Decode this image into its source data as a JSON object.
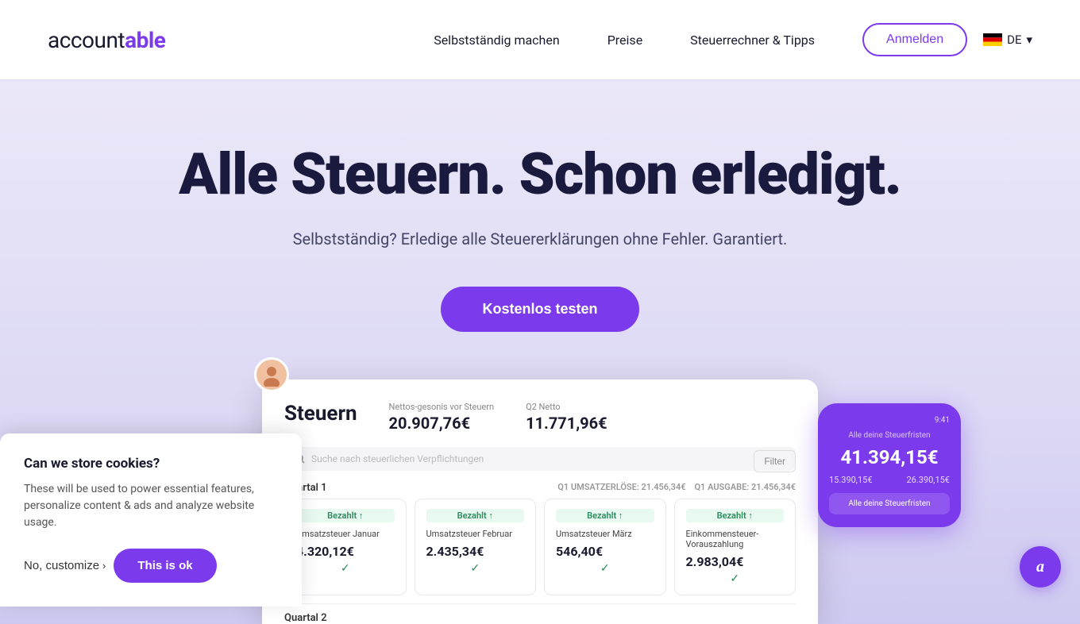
{
  "nav": {
    "logo_prefix": "account",
    "logo_accent": "able",
    "links": [
      {
        "label": "Selbstständig machen",
        "id": "selbststaendig"
      },
      {
        "label": "Preise",
        "id": "preise"
      },
      {
        "label": "Steuerrechner & Tipps",
        "id": "steuerrechner"
      }
    ],
    "anmelden_label": "Anmelden",
    "lang_code": "DE",
    "lang_caret": "▾"
  },
  "hero": {
    "title": "Alle Steuern. Schon erledigt.",
    "subtitle": "Selbstständig? Erledige alle Steuererklärungen ohne Fehler. Garantiert.",
    "cta_label": "Kostenlos testen"
  },
  "app_preview": {
    "title": "Steuern",
    "stat1_label": "Nettos-gesonis vor Steuern",
    "stat1_value": "20.907,76€",
    "stat2_label": "Q2 Netto",
    "stat2_value": "11.771,96€",
    "search_placeholder": "Suche nach steuerlichen Verpflichtungen",
    "filter_label": "Filter",
    "quartal1_label": "Quartal 1",
    "quartal1_meta1": "Q1 UMSATZERLÖSE: 21.456,34€",
    "quartal1_meta2": "Q1 AUSGABE: 21.456,34€",
    "cards": [
      {
        "paid_label": "Bezahlt",
        "name": "Umsatzsteuer Januar",
        "amount": "4.320,12€",
        "check": "✓"
      },
      {
        "paid_label": "Bezahlt",
        "name": "Umsatzsteuer Februar",
        "amount": "2.435,34€",
        "check": "✓"
      },
      {
        "paid_label": "Bezahlt",
        "name": "Umsatzsteuer März",
        "amount": "546,40€",
        "check": "✓"
      },
      {
        "paid_label": "Bezahlt",
        "name": "Einkommensteuer-Vorauszahlung",
        "amount": "2.983,04€",
        "check": "✓"
      }
    ],
    "quartal2_label": "Quartal 2"
  },
  "mobile": {
    "time": "9:41",
    "amount": "41.394,15€",
    "row1_left": "15.390,15€",
    "row1_right": "26.390,15€",
    "footer_label": "Alle deine Steuerfristen"
  },
  "cookie": {
    "title": "Can we store cookies?",
    "text": "These will be used to power essential features, personalize content & ads and analyze website usage.",
    "no_label": "No, customize",
    "ok_label": "This is ok"
  },
  "chat_bubble": {
    "icon": "a"
  }
}
